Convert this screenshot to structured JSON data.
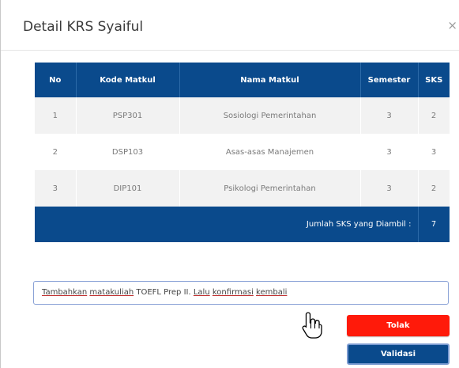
{
  "modal": {
    "title": "Detail KRS Syaiful",
    "close_symbol": "×"
  },
  "table": {
    "headers": [
      "No",
      "Kode Matkul",
      "Nama Matkul",
      "Semester",
      "SKS"
    ],
    "rows": [
      {
        "no": "1",
        "kode": "PSP301",
        "nama": "Sosiologi Pemerintahan",
        "semester": "3",
        "sks": "2"
      },
      {
        "no": "2",
        "kode": "DSP103",
        "nama": "Asas-asas Manajemen",
        "semester": "3",
        "sks": "3"
      },
      {
        "no": "3",
        "kode": "DIP101",
        "nama": "Psikologi Pemerintahan",
        "semester": "3",
        "sks": "2"
      }
    ],
    "total_label": "Jumlah SKS yang Diambil :",
    "total_value": "7"
  },
  "note": {
    "w1": "Tambahkan",
    "w2": "matakuliah",
    "mid": "TOEFL Prep II.",
    "w3": "Lalu",
    "w4": "konfirmasi",
    "w5": "kembali"
  },
  "buttons": {
    "tolak": "Tolak",
    "validasi": "Validasi"
  },
  "colors": {
    "header_bg": "#0a4a8c",
    "reject": "#ff1a0a",
    "validate": "#0a4a8c"
  }
}
